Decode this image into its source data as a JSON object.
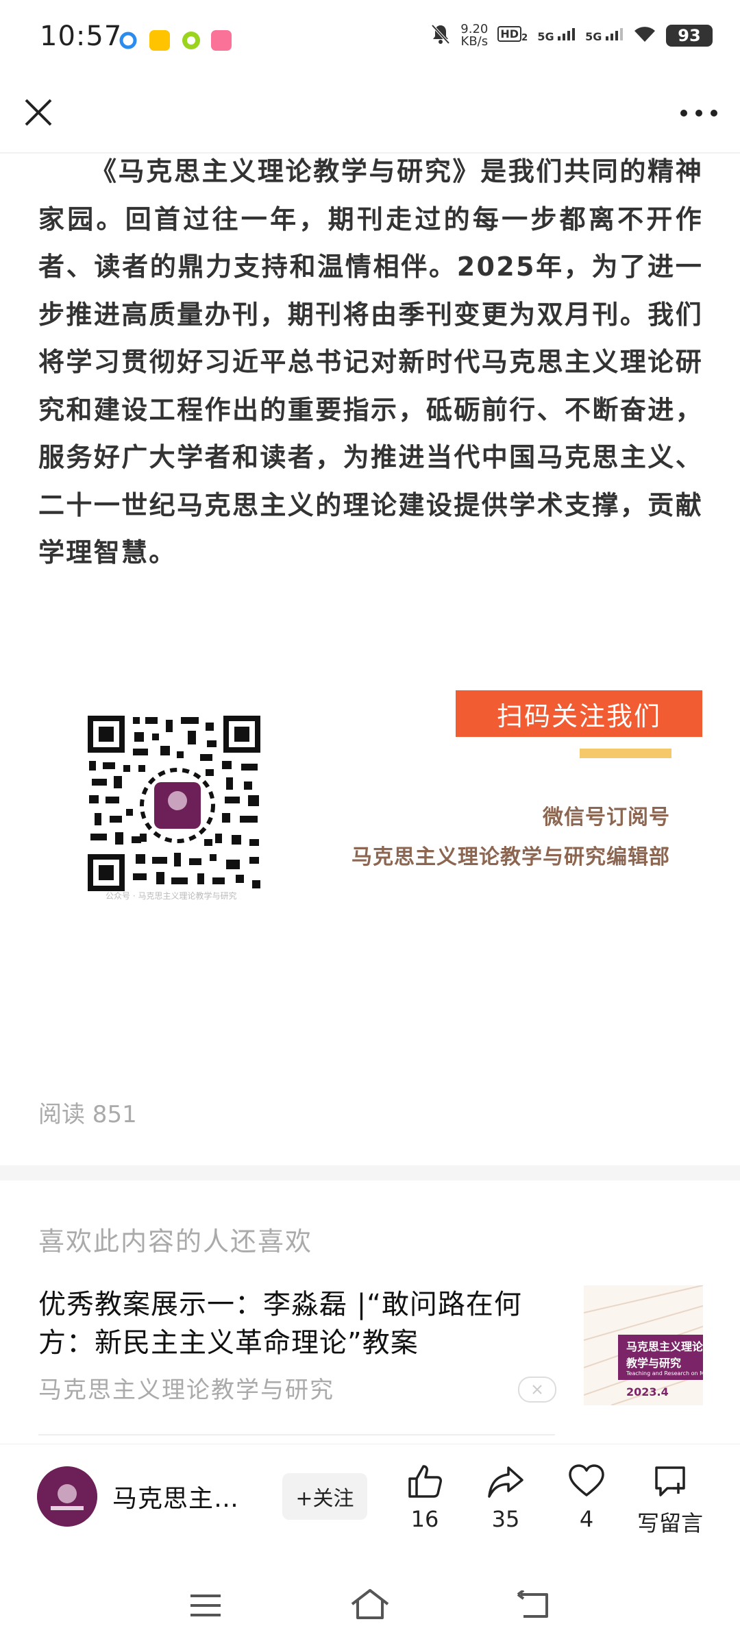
{
  "status_bar": {
    "time": "10:57",
    "network_speed_value": "9.20",
    "network_speed_unit": "KB/s",
    "hd_label": "HD",
    "hd_sub": "2",
    "sim1": "5G",
    "sim2": "5G",
    "battery": "93",
    "icons": [
      "app-blue-ring-icon",
      "meituan-icon",
      "app-green-icon",
      "bilibili-icon",
      "mute-bell-icon",
      "signal-icon",
      "wifi-icon",
      "battery-icon"
    ]
  },
  "nav": {
    "close_icon": "close-icon",
    "more_icon": "more-icon"
  },
  "article": {
    "paragraph": "《马克思主义理论教学与研究》是我们共同的精神家园。回首过往一年，期刊走过的每一步都离不开作者、读者的鼎力支持和温情相伴。2025年，为了进一步推进高质量办刊，期刊将由季刊变更为双月刊。我们将学习贯彻好习近平总书记对新时代马克思主义理论研究和建设工程作出的重要指示，砥砺前行、不断奋进，服务好广大学者和读者，为推进当代中国马克思主义、二十一世纪马克思主义的理论建设提供学术支撑，贡献学理智慧。"
  },
  "qr": {
    "banner": "扫码关注我们",
    "line1": "微信号订阅号",
    "line2": "马克思主义理论教学与研究编辑部",
    "caption": "公众号 · 马克思主义理论教学与研究"
  },
  "read_count": "阅读 851",
  "recommend": {
    "heading": "喜欢此内容的人还喜欢",
    "title": "优秀教案展示一：李淼磊 |“敢问路在何方：新民主主义革命理论”教案",
    "source": "马克思主义理论教学与研究",
    "thumb_title_line1": "马克思主义理论",
    "thumb_title_line2": "教学与研究",
    "thumb_subtitle": "Teaching and Research on Marxism",
    "thumb_issue": "2023.4"
  },
  "bottom_bar": {
    "account_name": "马克思主…",
    "follow_label": "+关注",
    "like_count": "16",
    "share_count": "35",
    "favorite_count": "4",
    "comment_label": "写留言"
  },
  "colors": {
    "banner": "#f25c32",
    "underline": "#f5c96a",
    "info_text": "#8c6650",
    "brand_purple": "#6d1f57"
  }
}
